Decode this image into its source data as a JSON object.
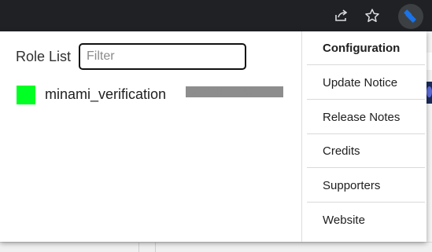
{
  "toolbar": {
    "share_icon": "share-icon",
    "star_icon": "star-icon",
    "extension_icon": "hammer-icon"
  },
  "popup": {
    "title": "Role List",
    "filter": {
      "placeholder": "Filter",
      "value": ""
    },
    "roles": [
      {
        "color": "#00ff22",
        "name": "minami_verification",
        "id": "997874687386"
      }
    ]
  },
  "menu": {
    "items": [
      {
        "label": "Configuration",
        "active": true
      },
      {
        "label": "Update Notice",
        "active": false
      },
      {
        "label": "Release Notes",
        "active": false
      },
      {
        "label": "Credits",
        "active": false
      },
      {
        "label": "Supporters",
        "active": false
      },
      {
        "label": "Website",
        "active": false
      }
    ]
  },
  "colors": {
    "toolbar_bg": "#202124",
    "accent_blue": "#1a73e8",
    "role_green": "#00ff22"
  }
}
